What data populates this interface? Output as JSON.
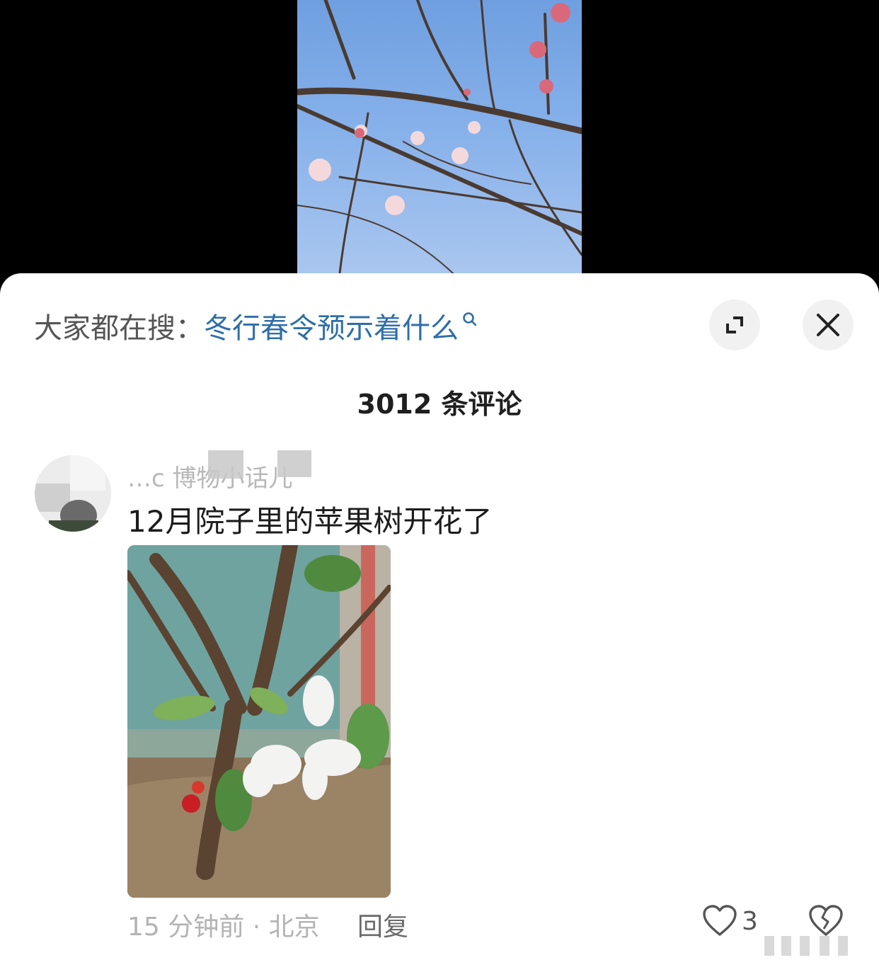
{
  "search": {
    "prefix": "大家都在搜：",
    "query": "冬行春令预示着什么"
  },
  "header": {
    "comment_count": "3012 条评论"
  },
  "comment": {
    "username": "…c 博物小话儿",
    "text": "12月院子里的苹果树开花了",
    "time_location": "15 分钟前 · 北京",
    "reply_label": "回复",
    "like_count": "3"
  },
  "icons": {
    "search": "search-icon",
    "expand": "expand-icon",
    "close": "close-icon",
    "like": "heart-icon",
    "dislike": "broken-heart-icon"
  },
  "colors": {
    "search_query": "#2e6ea9",
    "background_top": "#000000",
    "sheet": "#ffffff"
  }
}
